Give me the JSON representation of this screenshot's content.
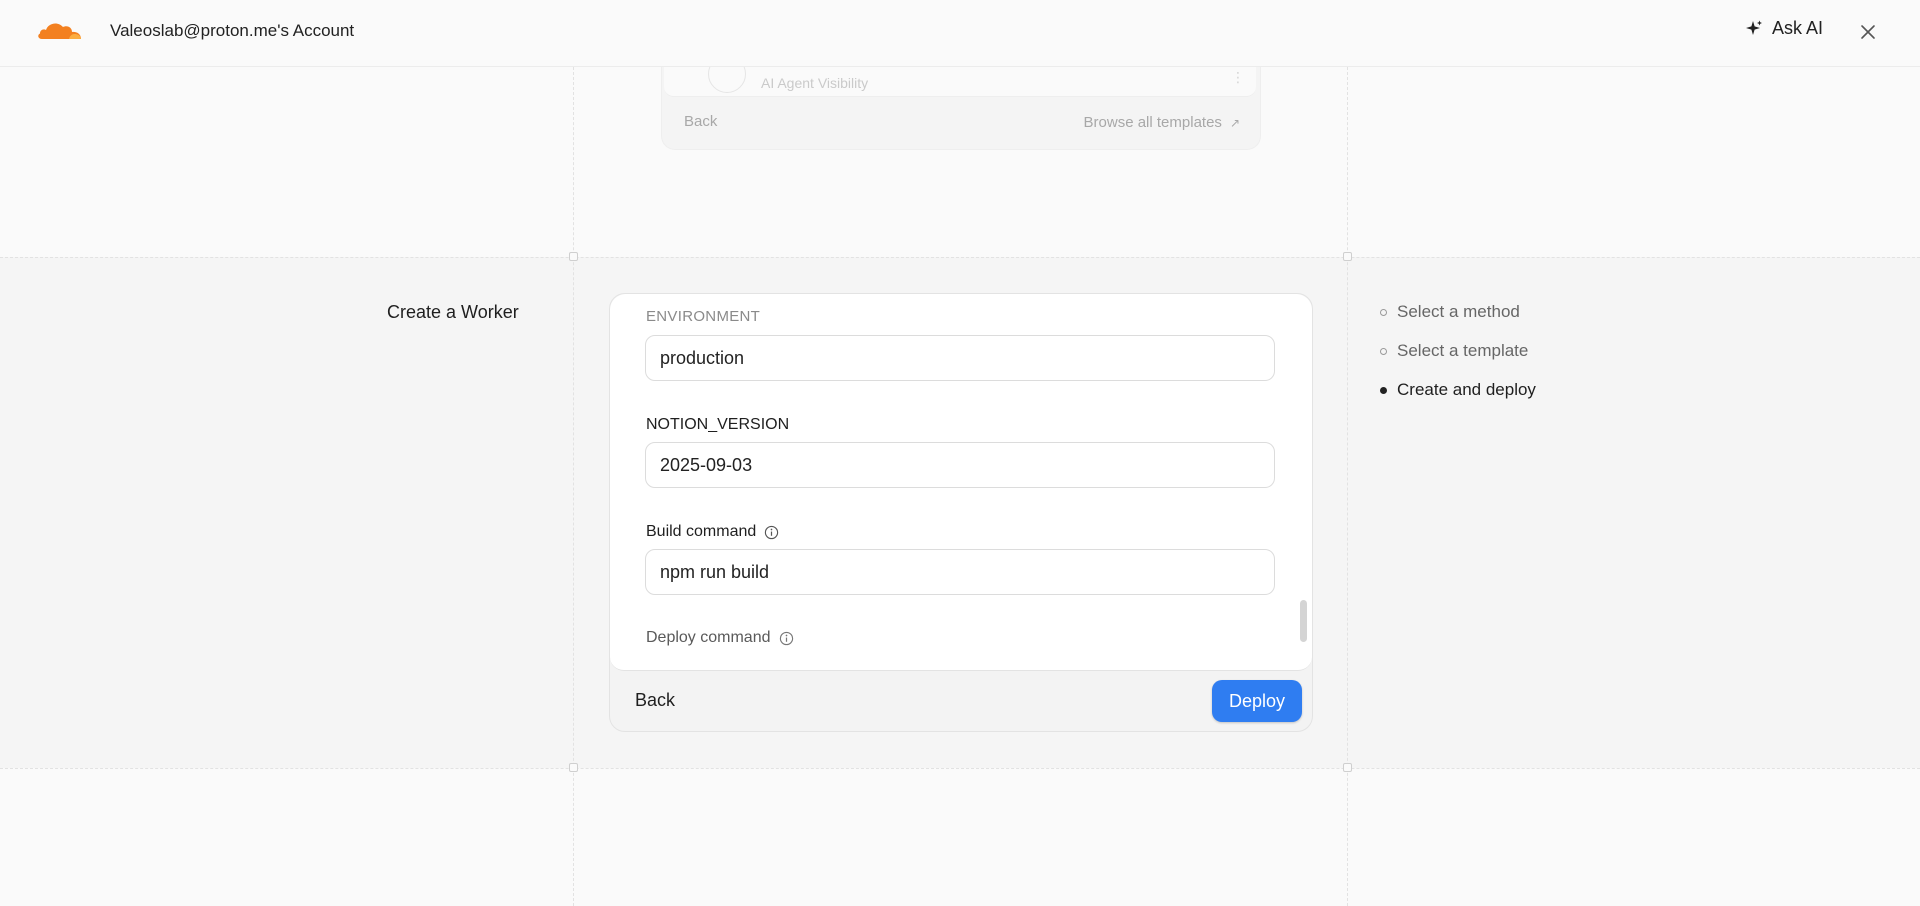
{
  "header": {
    "account_title": "Valeoslab@proton.me's Account",
    "ask_ai_label": "Ask AI",
    "brand_color": "#f38020"
  },
  "previous_step": {
    "item_label": "AI Agent Visibility",
    "back_label": "Back",
    "browse_label": "Browse all templates",
    "browse_arrow": "↗"
  },
  "section_title": "Create a Worker",
  "form": {
    "environment_label": "ENVIRONMENT",
    "environment_value": "production",
    "notion_version_label": "NOTION_VERSION",
    "notion_version_value": "2025-09-03",
    "build_command_label": "Build command",
    "build_command_value": "npm run build",
    "deploy_command_label": "Deploy command"
  },
  "footer": {
    "back_label": "Back",
    "deploy_label": "Deploy",
    "deploy_color": "#2f7df1"
  },
  "steps": [
    {
      "label": "Select a method",
      "active": false
    },
    {
      "label": "Select a template",
      "active": false
    },
    {
      "label": "Create and deploy",
      "active": true
    }
  ]
}
